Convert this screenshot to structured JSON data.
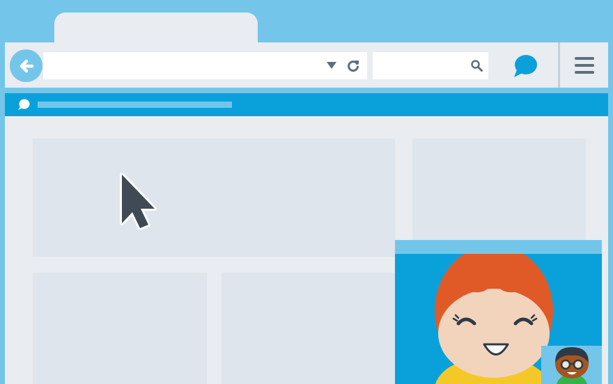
{
  "browser": {
    "tab": {
      "title": ""
    },
    "toolbar": {
      "back_icon": "arrow-left-icon",
      "url": {
        "value": "",
        "placeholder": ""
      },
      "dropdown_icon": "triangle-down-icon",
      "reload_icon": "reload-icon",
      "search": {
        "value": "",
        "placeholder": ""
      },
      "search_icon": "magnifier-icon",
      "chat_icon": "speech-bubble-icon",
      "menu_icon": "hamburger-menu-icon"
    },
    "notification": {
      "icon": "speech-bubble-icon",
      "text": ""
    }
  },
  "video_call": {
    "header_title": "",
    "caller": "cartoon-girl-red-hair",
    "self_view": "cartoon-boy-glasses"
  },
  "colors": {
    "background": "#73c6ea",
    "chrome": "#e9ecf0",
    "accent": "#0aa1db",
    "placeholder_block": "#dfe5ec",
    "icon_gray": "#5f6e7a"
  }
}
